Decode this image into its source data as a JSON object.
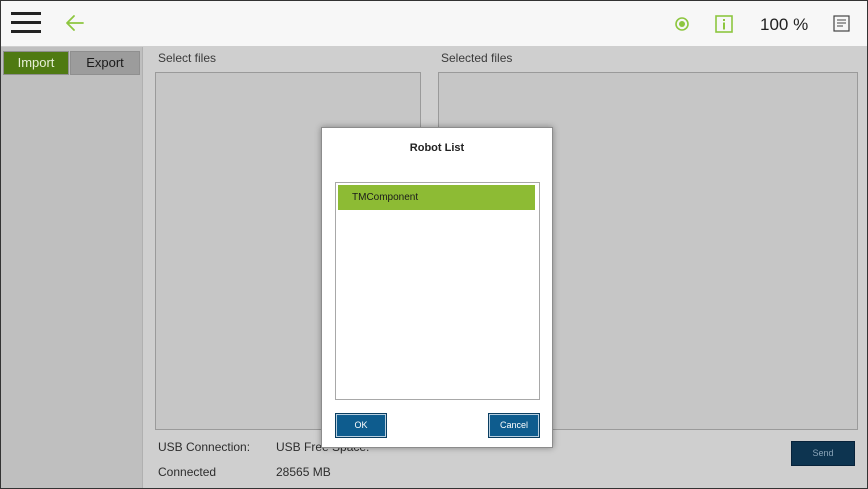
{
  "header": {
    "zoom": "100 %",
    "icons": [
      "menu-icon",
      "back-arrow-icon",
      "status-target-icon",
      "info-icon",
      "panel-icon"
    ],
    "accent_color": "#8dc63f"
  },
  "tabs": {
    "import": "Import",
    "export": "Export"
  },
  "columns": {
    "select_files": "Select files",
    "selected_files": "Selected files"
  },
  "footer": {
    "usb_connection_label": "USB Connection:",
    "usb_free_space_label": "USB Free Space:",
    "connection_status": "Connected",
    "free_space_value": "28565 MB",
    "send_label": "Send"
  },
  "modal": {
    "title": "Robot List",
    "items": [
      "TMComponent"
    ],
    "ok_label": "OK",
    "cancel_label": "Cancel"
  }
}
